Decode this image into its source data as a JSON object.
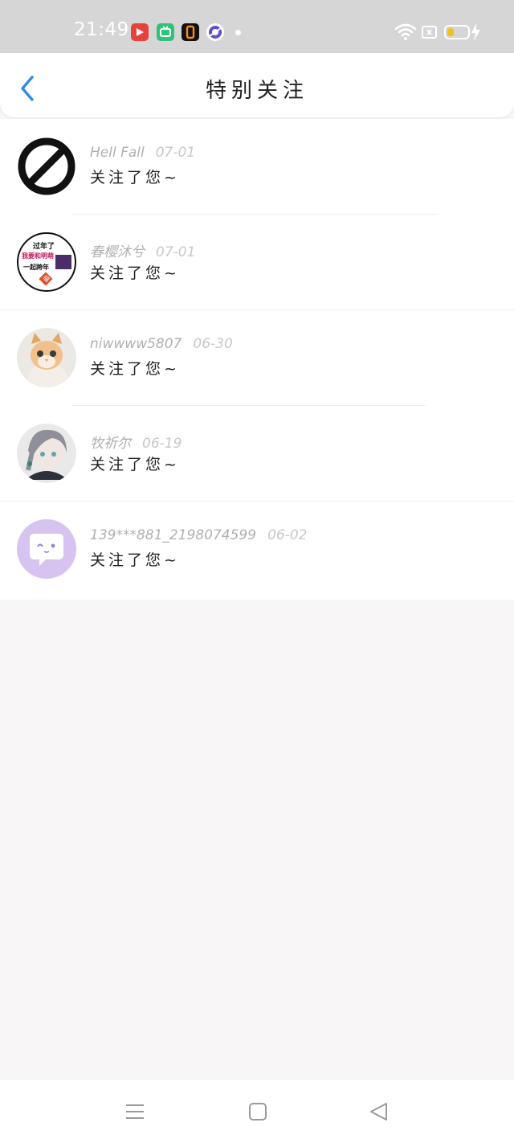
{
  "status_bar": {
    "time": "21:49",
    "apps": [
      "video-app-icon",
      "tv-app-icon",
      "zero-app-icon",
      "browser-app-icon"
    ]
  },
  "header": {
    "title": "特别关注",
    "back_icon": "chevron-left-icon"
  },
  "items": [
    {
      "name": "Hell Fall",
      "date": "07-01",
      "message": "关注了您~"
    },
    {
      "name": "春樱沐兮",
      "date": "07-01",
      "message": "关注了您~",
      "avatar_lines": [
        "过年了",
        "我要和明萌",
        "一起跨年"
      ],
      "avatar_stamp": "福"
    },
    {
      "name": "niwwww5807",
      "date": "06-30",
      "message": "关注了您~"
    },
    {
      "name": "牧祈尔",
      "date": "06-19",
      "message": "关注了您~"
    },
    {
      "name": "139***881_2198074599",
      "date": "06-02",
      "message": "关注了您~"
    }
  ],
  "colors": {
    "accent": "#2f8de4",
    "status_bar": "#d6d6d6",
    "background": "#f8f6f7"
  }
}
